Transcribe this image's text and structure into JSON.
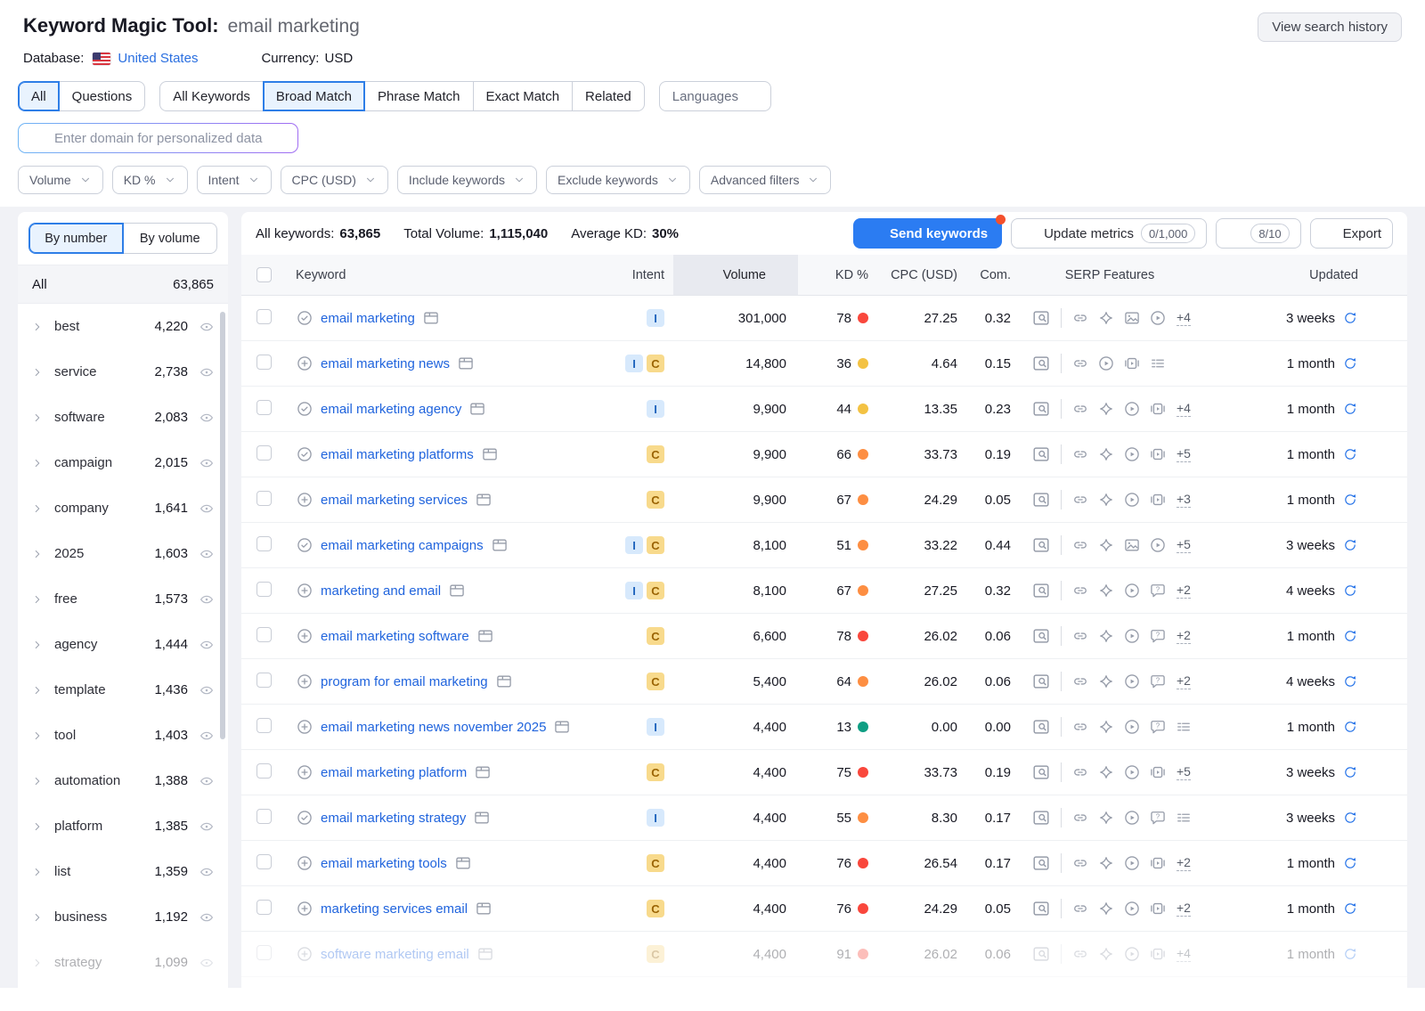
{
  "colors": {
    "accent_blue": "#2b7cf2",
    "link_blue": "#2064dd",
    "kd_red": "#f9473c",
    "kd_orange": "#fd8e42",
    "kd_yellow": "#f3c243",
    "kd_green": "#0f9e83",
    "intent_info_bg": "#d7e9fc",
    "intent_comm_bg": "#f8da8c"
  },
  "header": {
    "title": "Keyword Magic Tool:",
    "query": "email marketing",
    "database_label": "Database:",
    "database_value": "United States",
    "currency_label": "Currency:",
    "currency_value": "USD",
    "history_button": "View search history"
  },
  "tabs": {
    "group1": [
      {
        "label": "All",
        "selected": true
      },
      {
        "label": "Questions",
        "selected": false
      }
    ],
    "group2": [
      {
        "label": "All Keywords",
        "selected": false
      },
      {
        "label": "Broad Match",
        "selected": true
      },
      {
        "label": "Phrase Match",
        "selected": false
      },
      {
        "label": "Exact Match",
        "selected": false
      },
      {
        "label": "Related",
        "selected": false
      }
    ],
    "languages_label": "Languages"
  },
  "domain": {
    "placeholder": "Enter domain for personalized data"
  },
  "filters": [
    "Volume",
    "KD %",
    "Intent",
    "CPC (USD)",
    "Include keywords",
    "Exclude keywords",
    "Advanced filters"
  ],
  "sidebar": {
    "toggle": [
      {
        "label": "By number",
        "selected": true
      },
      {
        "label": "By volume",
        "selected": false
      }
    ],
    "all_label": "All",
    "all_count": "63,865",
    "items": [
      {
        "label": "best",
        "count": "4,220"
      },
      {
        "label": "service",
        "count": "2,738"
      },
      {
        "label": "software",
        "count": "2,083"
      },
      {
        "label": "campaign",
        "count": "2,015"
      },
      {
        "label": "company",
        "count": "1,641"
      },
      {
        "label": "2025",
        "count": "1,603"
      },
      {
        "label": "free",
        "count": "1,573"
      },
      {
        "label": "agency",
        "count": "1,444"
      },
      {
        "label": "template",
        "count": "1,436"
      },
      {
        "label": "tool",
        "count": "1,403"
      },
      {
        "label": "automation",
        "count": "1,388"
      },
      {
        "label": "platform",
        "count": "1,385"
      },
      {
        "label": "list",
        "count": "1,359"
      },
      {
        "label": "business",
        "count": "1,192"
      },
      {
        "label": "strategy",
        "count": "1,099",
        "faded": true
      }
    ]
  },
  "toolbar": {
    "stats": [
      {
        "label": "All keywords:",
        "value": "63,865"
      },
      {
        "label": "Total Volume:",
        "value": "1,115,040"
      },
      {
        "label": "Average KD:",
        "value": "30%"
      }
    ],
    "send_label": "Send keywords",
    "update_label": "Update metrics",
    "update_count": "0/1,000",
    "limit_badge": "8/10",
    "export_label": "Export"
  },
  "table": {
    "columns": {
      "keyword": "Keyword",
      "intent": "Intent",
      "volume": "Volume",
      "kd": "KD %",
      "cpc": "CPC (USD)",
      "com": "Com.",
      "serp": "SERP Features",
      "updated": "Updated"
    },
    "rows": [
      {
        "keyword": "email marketing",
        "added": true,
        "intents": [
          "I"
        ],
        "volume": "301,000",
        "kd": "78",
        "kd_level": "red",
        "cpc": "27.25",
        "com": "0.32",
        "serp": [
          "link",
          "diamond",
          "image",
          "play"
        ],
        "more": "+4",
        "updated": "3 weeks"
      },
      {
        "keyword": "email marketing news",
        "added": false,
        "intents": [
          "I",
          "C"
        ],
        "volume": "14,800",
        "kd": "36",
        "kd_level": "yellow",
        "cpc": "4.64",
        "com": "0.15",
        "serp": [
          "link",
          "play",
          "carousel",
          "list"
        ],
        "more": "",
        "updated": "1 month"
      },
      {
        "keyword": "email marketing agency",
        "added": true,
        "intents": [
          "I"
        ],
        "volume": "9,900",
        "kd": "44",
        "kd_level": "yellow",
        "cpc": "13.35",
        "com": "0.23",
        "serp": [
          "link",
          "diamond",
          "play",
          "carousel"
        ],
        "more": "+4",
        "updated": "1 month"
      },
      {
        "keyword": "email marketing platforms",
        "added": true,
        "intents": [
          "C"
        ],
        "volume": "9,900",
        "kd": "66",
        "kd_level": "orange",
        "cpc": "33.73",
        "com": "0.19",
        "serp": [
          "link",
          "diamond",
          "play",
          "carousel"
        ],
        "more": "+5",
        "updated": "1 month"
      },
      {
        "keyword": "email marketing services",
        "added": false,
        "intents": [
          "C"
        ],
        "volume": "9,900",
        "kd": "67",
        "kd_level": "orange",
        "cpc": "24.29",
        "com": "0.05",
        "serp": [
          "link",
          "diamond",
          "play",
          "carousel"
        ],
        "more": "+3",
        "updated": "1 month"
      },
      {
        "keyword": "email marketing campaigns",
        "added": true,
        "intents": [
          "I",
          "C"
        ],
        "volume": "8,100",
        "kd": "51",
        "kd_level": "orange",
        "cpc": "33.22",
        "com": "0.44",
        "serp": [
          "link",
          "diamond",
          "image",
          "play"
        ],
        "more": "+5",
        "updated": "3 weeks"
      },
      {
        "keyword": "marketing and email",
        "added": false,
        "intents": [
          "I",
          "C"
        ],
        "volume": "8,100",
        "kd": "67",
        "kd_level": "orange",
        "cpc": "27.25",
        "com": "0.32",
        "serp": [
          "link",
          "diamond",
          "play",
          "question"
        ],
        "more": "+2",
        "updated": "4 weeks"
      },
      {
        "keyword": "email marketing software",
        "added": false,
        "intents": [
          "C"
        ],
        "volume": "6,600",
        "kd": "78",
        "kd_level": "red",
        "cpc": "26.02",
        "com": "0.06",
        "serp": [
          "link",
          "diamond",
          "play",
          "question"
        ],
        "more": "+2",
        "updated": "1 month"
      },
      {
        "keyword": "program for email marketing",
        "added": false,
        "intents": [
          "C"
        ],
        "volume": "5,400",
        "kd": "64",
        "kd_level": "orange",
        "cpc": "26.02",
        "com": "0.06",
        "serp": [
          "link",
          "diamond",
          "play",
          "question"
        ],
        "more": "+2",
        "updated": "4 weeks"
      },
      {
        "keyword": "email marketing news november 2025",
        "added": false,
        "intents": [
          "I"
        ],
        "volume": "4,400",
        "kd": "13",
        "kd_level": "green",
        "cpc": "0.00",
        "com": "0.00",
        "serp": [
          "link",
          "diamond",
          "play",
          "question",
          "list"
        ],
        "more": "",
        "updated": "1 month"
      },
      {
        "keyword": "email marketing platform",
        "added": false,
        "intents": [
          "C"
        ],
        "volume": "4,400",
        "kd": "75",
        "kd_level": "red",
        "cpc": "33.73",
        "com": "0.19",
        "serp": [
          "link",
          "diamond",
          "play",
          "carousel"
        ],
        "more": "+5",
        "updated": "3 weeks"
      },
      {
        "keyword": "email marketing strategy",
        "added": true,
        "intents": [
          "I"
        ],
        "volume": "4,400",
        "kd": "55",
        "kd_level": "orange",
        "cpc": "8.30",
        "com": "0.17",
        "serp": [
          "link",
          "diamond",
          "play",
          "question",
          "list"
        ],
        "more": "",
        "updated": "3 weeks"
      },
      {
        "keyword": "email marketing tools",
        "added": false,
        "intents": [
          "C"
        ],
        "volume": "4,400",
        "kd": "76",
        "kd_level": "red",
        "cpc": "26.54",
        "com": "0.17",
        "serp": [
          "link",
          "diamond",
          "play",
          "carousel"
        ],
        "more": "+2",
        "updated": "1 month"
      },
      {
        "keyword": "marketing services email",
        "added": false,
        "intents": [
          "C"
        ],
        "volume": "4,400",
        "kd": "76",
        "kd_level": "red",
        "cpc": "24.29",
        "com": "0.05",
        "serp": [
          "link",
          "diamond",
          "play",
          "carousel"
        ],
        "more": "+2",
        "updated": "1 month"
      },
      {
        "keyword": "software marketing email",
        "added": false,
        "intents": [
          "C"
        ],
        "volume": "4,400",
        "kd": "91",
        "kd_level": "red",
        "cpc": "26.02",
        "com": "0.06",
        "serp": [
          "link",
          "diamond",
          "play",
          "carousel"
        ],
        "more": "+4",
        "updated": "1 month",
        "faded": true
      }
    ]
  }
}
